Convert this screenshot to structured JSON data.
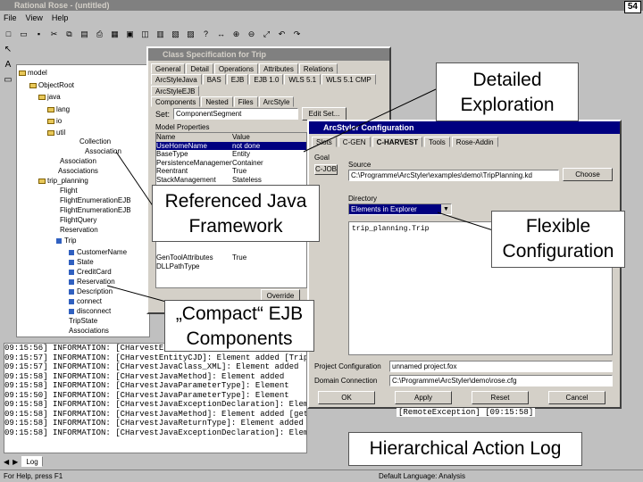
{
  "app": {
    "title": "Rational Rose - (untitled)",
    "menu": [
      "File",
      "View",
      "Help"
    ],
    "status_left": "For Help, press F1",
    "status_right": "Default Language: Analysis"
  },
  "browser": {
    "tree": [
      "model",
      "ObjectRoot",
      "java",
      "lang",
      "io",
      "util",
      "Collection",
      "Association",
      "Association",
      "Associations",
      "trip_planning",
      "Flight",
      "FlightEnumerationEJB",
      "FlightEnumerationEJB",
      "FlightQuery",
      "Reservation",
      "Trip",
      "CustomerName",
      "State",
      "CreditCard",
      "Reservation",
      "Description",
      "connect",
      "disconnect",
      "TripState",
      "Associations"
    ],
    "tab": "Log"
  },
  "class_spec": {
    "title": "Class Specification for Trip",
    "tabs_row1": [
      "General",
      "Detail",
      "Operations",
      "Attributes",
      "Relations"
    ],
    "tabs_row2": [
      "ArcStyleJava",
      "BAS",
      "EJB",
      "EJB 1.0",
      "WLS 5.1",
      "WLS 5.1 CMP",
      "ArcStyleEJB"
    ],
    "tabs_row3": [
      "Components",
      "Nested",
      "Files",
      "ArcStyle"
    ],
    "set_label": "Set:",
    "set_value": "ComponentSegment",
    "edit_set": "Edit Set...",
    "model_properties": "Model Properties",
    "columns": [
      "Name",
      "Value"
    ],
    "properties": [
      [
        "UseHomeName",
        "not done"
      ],
      [
        "BaseType",
        "Entity"
      ],
      [
        "PersistenceManagement",
        "Container"
      ],
      [
        "Reentrant",
        "True"
      ],
      [
        "StackManagement",
        "Stateless"
      ],
      [
        "GenToolAttributes",
        "True"
      ],
      [
        "DLLPathType",
        ""
      ]
    ],
    "override": "Override"
  },
  "arcstyler": {
    "title": "ArcStyler Configuration",
    "tabs": [
      "Slots",
      "C-GEN",
      "C-HARVEST",
      "Tools",
      "Rose-Addin"
    ],
    "goal": "Goal",
    "c_job": "C-JOB",
    "source_label": "Source",
    "source_value": "C:\\Programme\\ArcStyler\\examples\\demo\\TripPlanning.kd",
    "choose_button": "Choose",
    "directory_label": "Directory",
    "explorer_select": "Elements in Explorer",
    "package_value": "trip_planning.Trip",
    "project_config_label": "Project Configuration",
    "project_config_value": "unnamed project.fox",
    "domain_connection_label": "Domain Connection",
    "domain_connection_value": "C:\\Programme\\ArcStyler\\demo\\rose.cfg",
    "buttons": [
      "OK",
      "Apply",
      "Reset",
      "Cancel"
    ]
  },
  "log_lines": [
    "09:15:56]  INFORMATION: [CHarvestEJBRoot] Element added [Trip]",
    "09:15:57]  INFORMATION: [CHarvestEntityCJD]: Element added [Trip]",
    "09:15:57]      INFORMATION: [CHarvestJavaClass_XML]: Element added",
    "09:15:58]        INFORMATION: [CHarvestJavaMethod]: Element added",
    "09:15:58]          INFORMATION: [CHarvestJavaParameterType]: Element",
    "09:15:50]          INFORMATION: [CHarvestJavaParameterType]: Element",
    "09:15:58]          INFORMATION: [CHarvestJavaExceptionDeclaration]: Elem",
    "09:15:58]          INFORMATION: [CHarvestJavaMethod]: Element added [getDescription] [09:15:58]",
    "09:15:58]          INFORMATION: [CHarvestJavaReturnType]: Element added [String] [09:15:58]",
    "09:15:58]          INFORMATION: [CHarvestJavaExceptionDeclaration]: Element added"
  ],
  "log_tail": "[RemoteException] [09:15:58]",
  "callouts": {
    "detailed": "Detailed Exploration",
    "referenced": "Referenced Java Framework",
    "flexible": "Flexible Configuration",
    "compact": "„Compact“ EJB Components",
    "hierarchical": "Hierarchical Action Log"
  },
  "corner_badge": "54"
}
